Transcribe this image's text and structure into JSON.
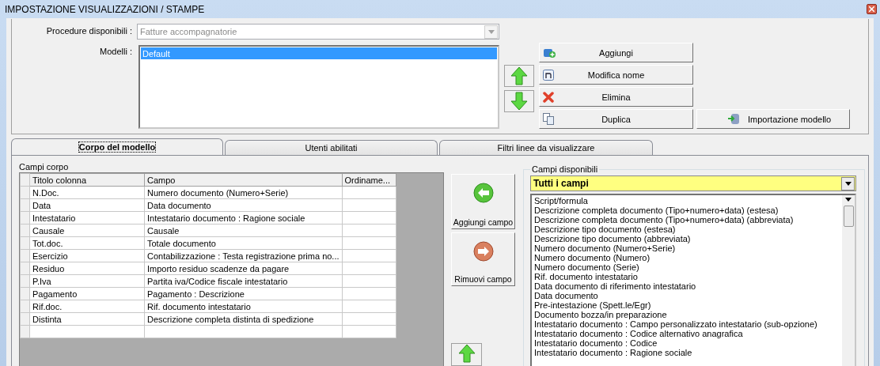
{
  "window": {
    "title": "IMPOSTAZIONE VISUALIZZAZIONI / STAMPE"
  },
  "procedure": {
    "label": "Procedure disponibili :",
    "value": "Fatture accompagnatorie",
    "disabled": true
  },
  "models": {
    "label": "Modelli :",
    "items": [
      {
        "label": "Default",
        "selected": true
      }
    ]
  },
  "model_buttons": [
    {
      "label": "Aggiungi"
    },
    {
      "label": "Modifica nome"
    },
    {
      "label": "Elimina"
    },
    {
      "label": "Duplica"
    }
  ],
  "import_button": {
    "label": "Importazione modello"
  },
  "tabs": [
    {
      "label": "Corpo del modello",
      "selected": true
    },
    {
      "label": "Utenti abilitati",
      "selected": false
    },
    {
      "label": "Filtri linee da visualizzare",
      "selected": false
    }
  ],
  "body_fields": {
    "label": "Campi corpo",
    "columns": [
      "Titolo colonna",
      "Campo",
      "Ordiname..."
    ],
    "rows": [
      [
        "N.Doc.",
        "Numero documento (Numero+Serie)"
      ],
      [
        "Data",
        "Data documento"
      ],
      [
        "Intestatario",
        "Intestatario documento : Ragione sociale"
      ],
      [
        "Causale",
        "Causale"
      ],
      [
        "Tot.doc.",
        "Totale documento"
      ],
      [
        "Esercizio",
        "Contabilizzazione : Testa registrazione prima no..."
      ],
      [
        "Residuo",
        "Importo residuo scadenze da pagare"
      ],
      [
        "P.Iva",
        "Partita iva/Codice fiscale intestatario"
      ],
      [
        "Pagamento",
        "Pagamento : Descrizione"
      ],
      [
        "Rif.doc.",
        "Rif. documento intestatario"
      ],
      [
        "Distinta",
        "Descrizione completa distinta di spedizione"
      ]
    ]
  },
  "field_buttons": [
    {
      "label": "Aggiungi campo"
    },
    {
      "label": "Rimuovi campo"
    }
  ],
  "available_fields": {
    "label": "Campi disponibili",
    "filter": "Tutti i campi",
    "items": [
      "Script/formula",
      "Descrizione completa documento (Tipo+numero+data) (estesa)",
      "Descrizione completa documento (Tipo+numero+data) (abbreviata)",
      "Descrizione tipo documento (estesa)",
      "Descrizione tipo documento (abbreviata)",
      "Numero documento (Numero+Serie)",
      "Numero documento (Numero)",
      "Numero documento (Serie)",
      "Rif. documento intestatario",
      "Data documento di riferimento intestatario",
      "Data documento",
      "Pre-intestazione (Spett.le/Egr)",
      "Documento bozza/in preparazione",
      "Intestatario documento : Campo personalizzato intestatario (sub-opzione)",
      "Intestatario documento : Codice alternativo anagrafica",
      "Intestatario documento : Codice",
      "Intestatario documento : Ragione sociale"
    ]
  }
}
